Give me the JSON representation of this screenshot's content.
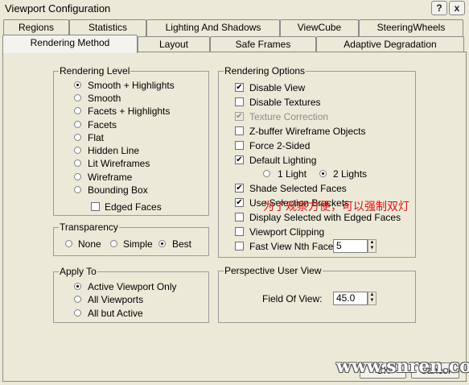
{
  "window": {
    "title": "Viewport Configuration",
    "help_label": "?",
    "close_label": "x"
  },
  "tabs_row1": [
    "Regions",
    "Statistics",
    "Lighting And Shadows",
    "ViewCube",
    "SteeringWheels"
  ],
  "tabs_row2": [
    "Rendering Method",
    "Layout",
    "Safe Frames",
    "Adaptive Degradation"
  ],
  "active_tab": "Rendering Method",
  "rendering_level": {
    "label": "Rendering Level",
    "options": [
      "Smooth + Highlights",
      "Smooth",
      "Facets + Highlights",
      "Facets",
      "Flat",
      "Hidden Line",
      "Lit Wireframes",
      "Wireframe",
      "Bounding Box"
    ],
    "selected": "Smooth + Highlights",
    "edged_faces_label": "Edged Faces",
    "edged_faces_checked": false
  },
  "transparency": {
    "label": "Transparency",
    "options": [
      "None",
      "Simple",
      "Best"
    ],
    "selected": "Best"
  },
  "apply_to": {
    "label": "Apply To",
    "options": [
      "Active Viewport Only",
      "All Viewports",
      "All but Active"
    ],
    "selected": "Active Viewport Only"
  },
  "rendering_options": {
    "label": "Rendering Options",
    "disable_view": {
      "label": "Disable View",
      "checked": true
    },
    "disable_textures": {
      "label": "Disable Textures",
      "checked": false
    },
    "texture_correction": {
      "label": "Texture Correction",
      "checked": true,
      "disabled": true
    },
    "zbuffer_wireframe": {
      "label": "Z-buffer Wireframe Objects",
      "checked": false
    },
    "force_2_sided": {
      "label": "Force 2-Sided",
      "checked": false
    },
    "default_lighting": {
      "label": "Default Lighting",
      "checked": true
    },
    "lights_options": [
      "1 Light",
      "2 Lights"
    ],
    "lights_selected": "2 Lights",
    "shade_selected_faces": {
      "label": "Shade Selected Faces",
      "checked": true
    },
    "use_selection_brackets": {
      "label": "Use Selection Brackets",
      "checked": true
    },
    "display_selected_edged": {
      "label": "Display Selected with Edged Faces",
      "checked": false
    },
    "viewport_clipping": {
      "label": "Viewport Clipping",
      "checked": false
    },
    "fast_view_nth_faces": {
      "label": "Fast View Nth Faces:",
      "checked": false,
      "value": "5"
    }
  },
  "perspective": {
    "label": "Perspective User View",
    "fov_label": "Field Of View:",
    "fov_value": "45.0"
  },
  "annotation_text": "为了观察方便，可以强制双灯",
  "watermark_text": "www.snren.com",
  "buttons": {
    "ok_label": "OK",
    "cancel_label": "Cancel"
  }
}
